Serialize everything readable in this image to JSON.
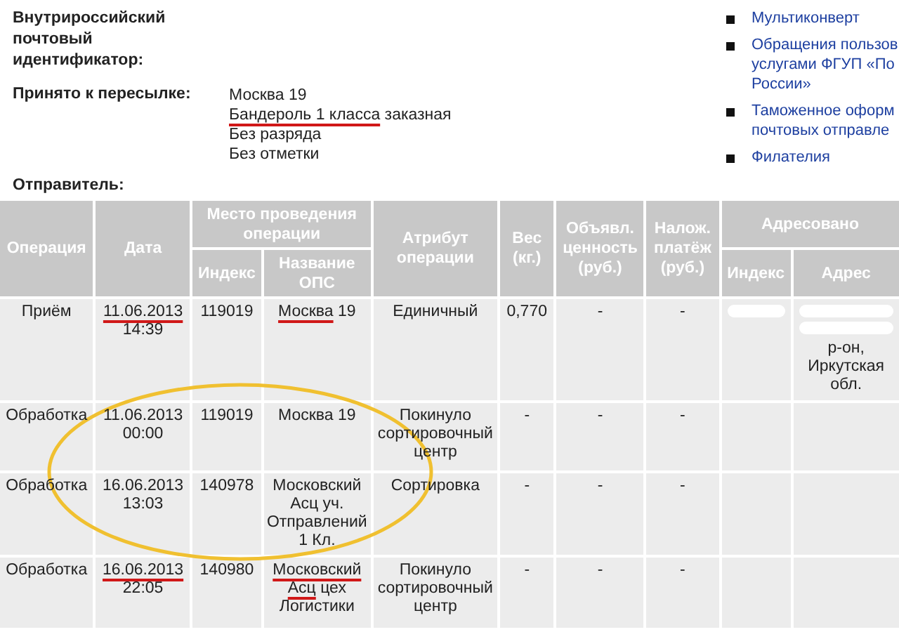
{
  "info": {
    "id_label": "Внутрироссийский почтовый идентификатор:",
    "accepted_label": "Принято к пересылке:",
    "accepted_lines": [
      [
        {
          "text": "Москва 19",
          "underline": false
        }
      ],
      [
        {
          "text": "Бандероль 1 класса",
          "underline": true
        },
        {
          "text": "заказная",
          "underline": false
        }
      ],
      [
        {
          "text": "Без разряда",
          "underline": false
        }
      ],
      [
        {
          "text": "Без отметки",
          "underline": false
        }
      ]
    ],
    "sender_label": "Отправитель:"
  },
  "sidebar": {
    "links": [
      {
        "lines": [
          "Мультиконверт"
        ]
      },
      {
        "lines": [
          "Обращения пользов",
          "услугами ФГУП «По",
          "России»"
        ]
      },
      {
        "lines": [
          "Таможенное оформ",
          "почтовых отправле"
        ]
      },
      {
        "lines": [
          "Филателия"
        ]
      }
    ]
  },
  "table": {
    "headers": {
      "operation": "Операция",
      "date": "Дата",
      "place": "Место проведения операции",
      "index": "Индекс",
      "office": "Название ОПС",
      "attribute": "Атрибут операции",
      "weight": "Вес (кг.)",
      "declared": "Объявл. ценность (руб.)",
      "cod": "Налож. платёж (руб.)",
      "addressed": "Адресовано",
      "addr_index": "Индекс",
      "address": "Адрес"
    },
    "circle_annotation": true,
    "rows": [
      {
        "operation": "Приём",
        "date": [
          {
            "text": "11.06.2013",
            "underline": true
          },
          {
            "text": "14:39",
            "underline": false
          }
        ],
        "index": "119019",
        "office": [
          {
            "text": "Москва",
            "underline": true
          },
          {
            "text": "19",
            "underline": false
          }
        ],
        "attribute": "Единичный",
        "weight": "0,770",
        "declared": "-",
        "cod": "-",
        "redacted": true,
        "address": "р-он, Иркутская обл."
      },
      {
        "operation": "Обработка",
        "date": [
          {
            "text": "11.06.2013 00:00",
            "underline": false
          }
        ],
        "index": "119019",
        "office": [
          {
            "text": "Москва 19",
            "underline": false
          }
        ],
        "attribute": "Покинуло сортировочный центр",
        "weight": "-",
        "declared": "-",
        "cod": "-",
        "redacted": false
      },
      {
        "operation": "Обработка",
        "date": [
          {
            "text": "16.06.2013 13:03",
            "underline": false
          }
        ],
        "index": "140978",
        "office": [
          {
            "text": "Московский Асц уч. Отправлений 1 Кл.",
            "underline": false
          }
        ],
        "attribute": "Сортировка",
        "weight": "-",
        "declared": "-",
        "cod": "-",
        "redacted": false
      },
      {
        "operation": "Обработка",
        "date": [
          {
            "text": "16.06.2013",
            "underline": true
          },
          {
            "text": "22:05",
            "underline": false
          }
        ],
        "index": "140980",
        "office": [
          {
            "text": "Московский",
            "underline": true
          },
          {
            "text": "Асц",
            "underline": true
          },
          {
            "text": "цех Логистики",
            "underline": false
          }
        ],
        "attribute": "Покинуло сортировочный центр",
        "weight": "-",
        "declared": "-",
        "cod": "-",
        "redacted": false
      }
    ]
  }
}
